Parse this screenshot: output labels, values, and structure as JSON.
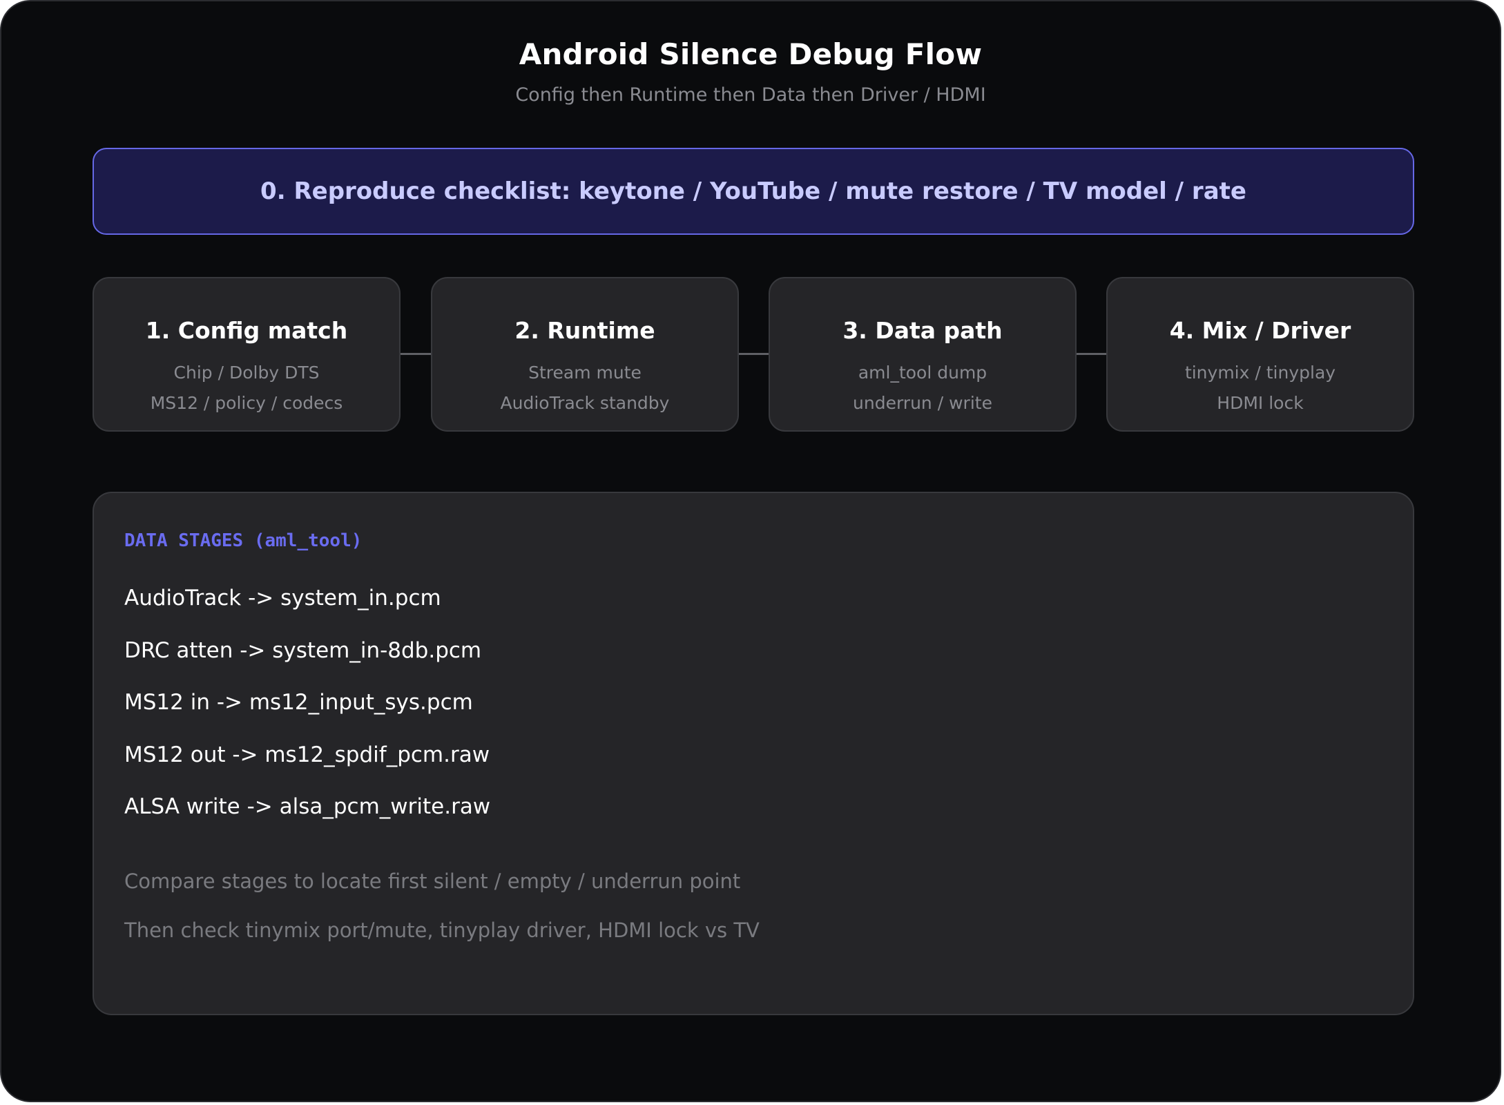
{
  "title": "Android Silence Debug Flow",
  "subtitle": "Config then Runtime then Data then Driver / HDMI",
  "checklist": "0. Reproduce checklist: keytone / YouTube / mute restore / TV model / rate",
  "colors": {
    "background": "#0a0b0d",
    "card": "#252528",
    "accent": "#6a6cf0",
    "checklist_fill": "#1c1b4a",
    "checklist_text": "#c9cbff",
    "muted_text": "#8a8b91"
  },
  "steps": [
    {
      "title": "1. Config match",
      "lines": [
        "Chip / Dolby DTS",
        "MS12 / policy / codecs"
      ]
    },
    {
      "title": "2. Runtime",
      "lines": [
        "Stream mute",
        "AudioTrack standby"
      ]
    },
    {
      "title": "3. Data path",
      "lines": [
        "aml_tool dump",
        "underrun / write"
      ]
    },
    {
      "title": "4. Mix / Driver",
      "lines": [
        "tinymix / tinyplay",
        "HDMI lock"
      ]
    }
  ],
  "data_stages": {
    "header": "DATA STAGES (aml_tool)",
    "items": [
      "AudioTrack -> system_in.pcm",
      "DRC atten -> system_in-8db.pcm",
      "MS12 in -> ms12_input_sys.pcm",
      "MS12 out -> ms12_spdif_pcm.raw",
      "ALSA write -> alsa_pcm_write.raw"
    ],
    "notes": [
      "Compare stages to locate first silent / empty / underrun point",
      "Then check tinymix port/mute, tinyplay driver, HDMI lock vs TV"
    ]
  }
}
